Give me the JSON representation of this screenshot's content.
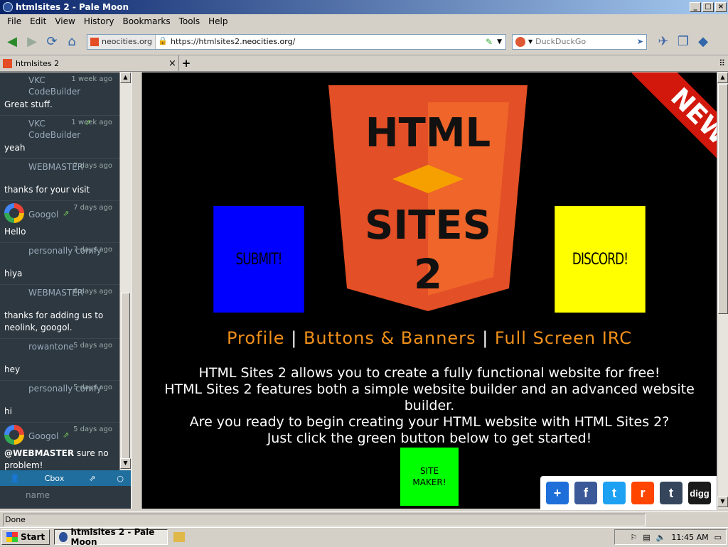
{
  "window": {
    "title": "htmlsites 2 - Pale Moon",
    "min": "_",
    "max": "□",
    "close": "×"
  },
  "menu": [
    "File",
    "Edit",
    "View",
    "History",
    "Bookmarks",
    "Tools",
    "Help"
  ],
  "toolbar": {
    "identity": "neocities.org",
    "url_prefix": "https://htmlsites2.",
    "url_domain": "neocities.org",
    "url_suffix": "/",
    "search_placeholder": "DuckDuckGo"
  },
  "tab": {
    "label": "htmlsites 2",
    "close": "×",
    "new": "+"
  },
  "sidebar": {
    "messages": [
      {
        "name": "VKC\nCodeBuilder",
        "time": "1 week ago",
        "text": "Great stuff.",
        "avatar": "none",
        "ext": false
      },
      {
        "name": "VKC\nCodeBuilder",
        "time": "1 week ago",
        "text": "yeah",
        "avatar": "none",
        "ext": true
      },
      {
        "name": "WEBMASTER",
        "time": "7 days ago",
        "text": "thanks for your visit",
        "avatar": "none",
        "ext": false
      },
      {
        "name": "Googol",
        "time": "7 days ago",
        "text": "Hello",
        "avatar": "google",
        "ext": true
      },
      {
        "name": "personally comfy",
        "time": "7 days ago",
        "text": "hiya",
        "avatar": "none",
        "ext": false
      },
      {
        "name": "WEBMASTER",
        "time": "6 days ago",
        "text": "thanks for adding us to neolink, googol.",
        "avatar": "none",
        "ext": false
      },
      {
        "name": "rowantone",
        "time": "5 days ago",
        "text": "hey",
        "avatar": "none",
        "ext": false
      },
      {
        "name": "personally comfy",
        "time": "5 days ago",
        "text": "hi",
        "avatar": "none",
        "ext": false
      },
      {
        "name": "Googol",
        "time": "5 days ago",
        "text_bold": "@WEBMASTER",
        "text": " sure no problem!",
        "avatar": "google",
        "ext": true
      }
    ],
    "cbox_label": "Cbox",
    "name_placeholder": "name"
  },
  "page": {
    "shield_line1": "HTML",
    "shield_line2": "SITES",
    "shield_line3": "2",
    "ribbon": "NEW",
    "submit": "SUBMIT!",
    "discord": "DISCORD!",
    "links": [
      "Profile",
      "Buttons & Banners",
      "Full Screen IRC"
    ],
    "link_sep": "|",
    "description": [
      "HTML Sites 2 allows you to create a fully functional website for free!",
      "HTML Sites 2 features both a simple website builder and an advanced website builder.",
      "Are you ready to begin creating your HTML website with HTML Sites 2?",
      "Just click the green button below to get started!"
    ],
    "site_maker": "SITE\nMAKER!",
    "colors": {
      "submit": "#0000ff",
      "discord": "#ffff00",
      "maker": "#00ff00",
      "links": "#f0901a"
    }
  },
  "share": [
    {
      "icon": "plus-share-icon",
      "glyph": "+",
      "color": "#1e6fd9"
    },
    {
      "icon": "facebook-icon",
      "glyph": "f",
      "color": "#3b5998"
    },
    {
      "icon": "twitter-icon",
      "glyph": "t",
      "color": "#1da1f2"
    },
    {
      "icon": "reddit-icon",
      "glyph": "r",
      "color": "#ff4500"
    },
    {
      "icon": "tumblr-icon",
      "glyph": "t",
      "color": "#35465c"
    },
    {
      "icon": "digg-icon",
      "glyph": "digg",
      "color": "#1a1a1a"
    }
  ],
  "status": "Done",
  "taskbar": {
    "start": "Start",
    "task": "htmlsites 2 - Pale Moon",
    "clock": "11:45 AM"
  }
}
